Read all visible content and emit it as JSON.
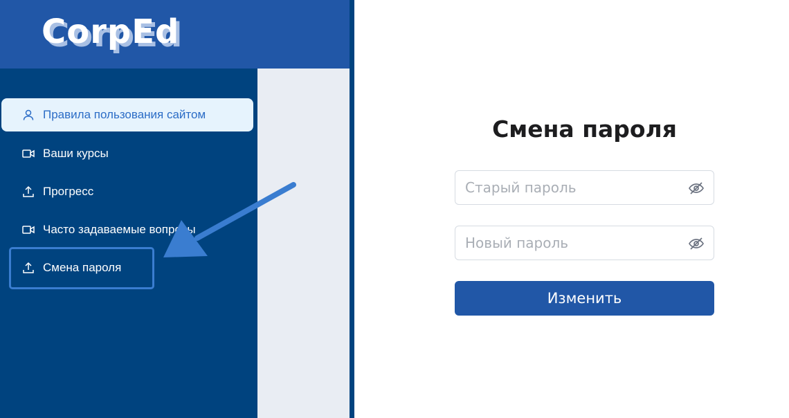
{
  "app": {
    "logo": "CorpEd"
  },
  "sidebar": {
    "items": [
      {
        "label": "Правила пользования сайтом",
        "icon": "user-icon",
        "active": true
      },
      {
        "label": "Ваши курсы",
        "icon": "video-icon",
        "active": false
      },
      {
        "label": "Прогресс",
        "icon": "upload-icon",
        "active": false
      },
      {
        "label": "Часто задаваемые вопросы",
        "icon": "video-icon",
        "active": false
      },
      {
        "label": "Смена пароля",
        "icon": "upload-icon",
        "active": false
      }
    ]
  },
  "form": {
    "title": "Смена пароля",
    "old_password_placeholder": "Старый пароль",
    "new_password_placeholder": "Новый пароль",
    "submit_label": "Изменить"
  },
  "colors": {
    "brand": "#2157a7",
    "sidebar": "#00437f",
    "active_item_bg": "#e6f3fd",
    "active_item_text": "#2b6cc6",
    "annotation": "#3a7dd0"
  }
}
